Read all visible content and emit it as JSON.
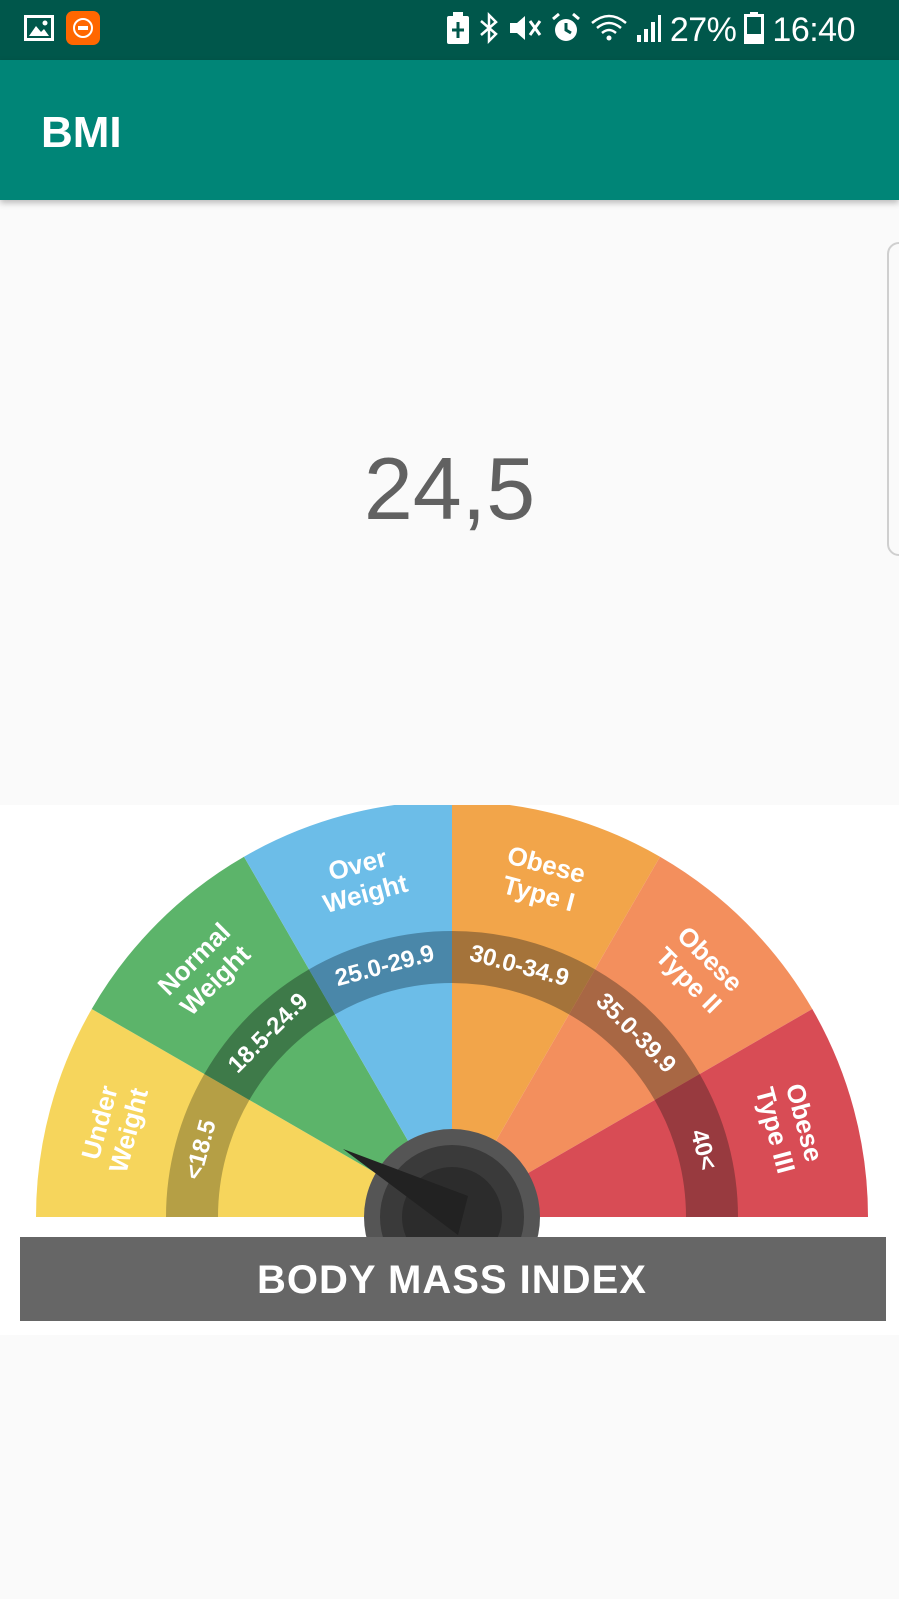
{
  "status_bar": {
    "battery": "27%",
    "time": "16:40",
    "icons": [
      "gallery-icon",
      "mi-app-icon",
      "battery-saver-icon",
      "bluetooth-icon",
      "mute-icon",
      "alarm-icon",
      "wifi-icon",
      "signal-icon",
      "battery-icon"
    ]
  },
  "app_bar": {
    "title": "BMI"
  },
  "result": {
    "bmi_value": "24,5"
  },
  "gauge": {
    "title": "BODY MASS INDEX",
    "segments": [
      {
        "line1": "Under",
        "line2": "Weight",
        "range": "<18.5",
        "color": "#f6d55c",
        "band": "#b59f45"
      },
      {
        "line1": "Normal",
        "line2": "Weight",
        "range": "18.5-24.9",
        "color": "#5cb46a",
        "band": "#3e7a49"
      },
      {
        "line1": "Over",
        "line2": "Weight",
        "range": "25.0-29.9",
        "color": "#6cbde8",
        "band": "#4a87a9"
      },
      {
        "line1": "Obese",
        "line2": "Type I",
        "range": "30.0-34.9",
        "color": "#f2a54a",
        "band": "#a4733a"
      },
      {
        "line1": "Obese",
        "line2": "Type II",
        "range": "35.0-39.9",
        "color": "#f38f5d",
        "band": "#a86744"
      },
      {
        "line1": "Obese",
        "line2": "Type III",
        "range": "40<",
        "color": "#d84c55",
        "band": "#983a3f"
      }
    ]
  }
}
